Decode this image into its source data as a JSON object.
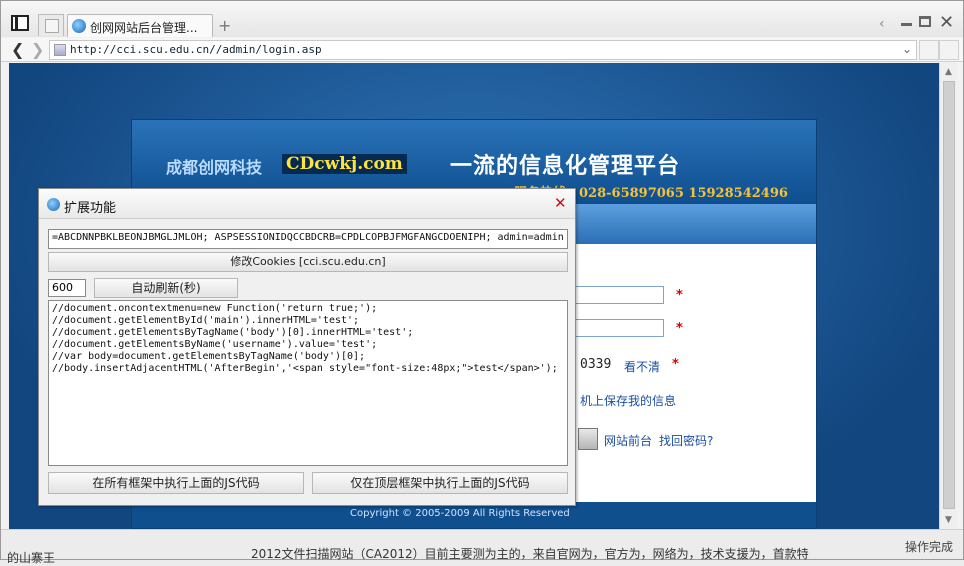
{
  "browser": {
    "tab_title": "创网网站后台管理...",
    "new_tab": "+",
    "url": "http://cci.scu.edu.cn//admin/login.asp",
    "status": "操作完成"
  },
  "login_page": {
    "brand": "成都创网科技",
    "brand_logo": "CDcwkj.com",
    "slogan": "一流的信息化管理平台",
    "hotline": "服务热线：028-65897065 15928542496",
    "captcha_partial": "0339",
    "refresh_captcha": "看不清",
    "required_mark": "*",
    "save_info_partial": "机上保存我的信息",
    "front_link": "网站前台",
    "forgot_link": "找回密码?",
    "copyright_partial": "Copyright © 2005-2009 All Rights Reserved"
  },
  "ext_dialog": {
    "title": "扩展功能",
    "close": "✕",
    "cookie_value": "=ABCDNNPBKLBEONJBMGLJMLOH; ASPSESSIONIDQCCBDCRB=CPDLCOPBJFMGFANGCDOENIPH; admin=admin",
    "modify_cookies_label": "修改Cookies [cci.scu.edu.cn]",
    "refresh_interval": "600",
    "auto_refresh_label": "自动刷新(秒)",
    "js_lines": [
      "//document.oncontextmenu=new Function('return true;');",
      "//document.getElementById('main').innerHTML='test';",
      "//document.getElementsByTagName('body')[0].innerHTML='test';",
      "//document.getElementsByName('username').value='test';",
      "//var body=document.getElementsByTagName('body')[0];",
      "//body.insertAdjacentHTML('AfterBegin','<span style=\"font-size:48px;\">test</span>');"
    ],
    "run_all_frames_label": "在所有框架中执行上面的JS代码",
    "run_top_frame_label": "仅在顶层框架中执行上面的JS代码"
  },
  "behind": {
    "left_text": "的山寨王",
    "bottom_text": "2012文件扫描网站（CA2012）目前主要测为主的，来自官网为，官方为，网络为，技术支援为，首款特"
  }
}
